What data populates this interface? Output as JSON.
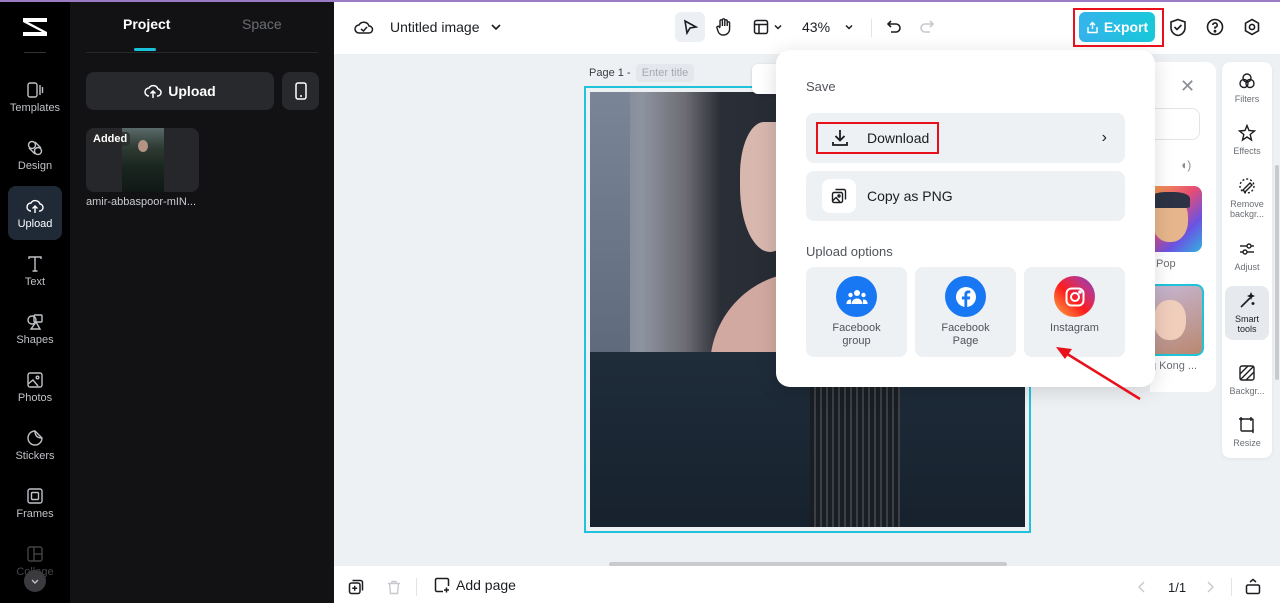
{
  "app": {
    "accent": "#19c2d8",
    "annotation_color": "#e8101a"
  },
  "rail": {
    "items": [
      {
        "label": "Templates",
        "icon": "templates-icon"
      },
      {
        "label": "Design",
        "icon": "design-icon"
      },
      {
        "label": "Upload",
        "icon": "cloud-upload-icon",
        "active": true
      },
      {
        "label": "Text",
        "icon": "text-icon"
      },
      {
        "label": "Shapes",
        "icon": "shapes-icon"
      },
      {
        "label": "Photos",
        "icon": "photos-icon"
      },
      {
        "label": "Stickers",
        "icon": "stickers-icon"
      },
      {
        "label": "Frames",
        "icon": "frames-icon"
      },
      {
        "label": "Collage",
        "icon": "collage-icon"
      }
    ]
  },
  "panel": {
    "tabs": [
      "Project",
      "Space"
    ],
    "upload_label": "Upload",
    "asset": {
      "badge": "Added",
      "name": "amir-abbaspoor-mIN..."
    }
  },
  "topbar": {
    "title": "Untitled image",
    "zoom": "43%",
    "export_label": "Export"
  },
  "canvas": {
    "page_label": "Page 1 -",
    "title_placeholder": "Enter title"
  },
  "bottombar": {
    "add_page": "Add page",
    "page_indicator": "1/1"
  },
  "popup": {
    "save_heading": "Save",
    "download": "Download",
    "copy_png": "Copy as PNG",
    "upload_heading": "Upload options",
    "options": [
      {
        "label": "Facebook group",
        "color": "#1877f2"
      },
      {
        "label": "Facebook Page",
        "color": "#1877f2"
      },
      {
        "label": "Instagram",
        "color": "#e1306c"
      }
    ]
  },
  "style_panel": {
    "styles": [
      "Pop",
      "g Kong ..."
    ]
  },
  "tools": [
    {
      "label": "Filters"
    },
    {
      "label": "Effects"
    },
    {
      "label": "Remove backgr..."
    },
    {
      "label": "Adjust"
    },
    {
      "label": "Smart tools",
      "active": true
    },
    {
      "label": "Backgr..."
    },
    {
      "label": "Resize"
    }
  ]
}
